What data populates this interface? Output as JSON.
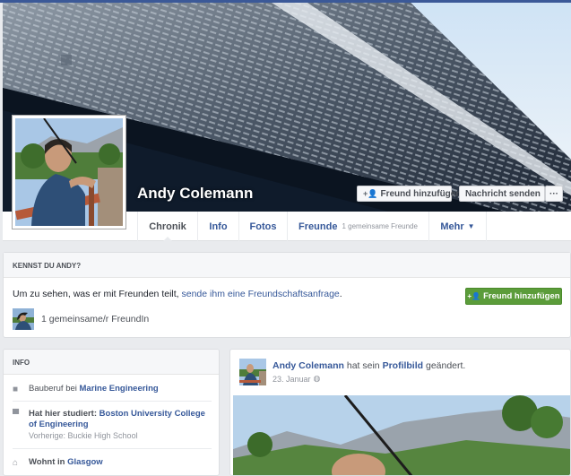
{
  "profile": {
    "name": "Andy Colemann"
  },
  "cover_actions": {
    "add_friend_label": "Freund hinzufügen",
    "send_message_label": "Nachricht senden",
    "more_label": "···"
  },
  "tabs": [
    {
      "label": "Chronik",
      "sub": ""
    },
    {
      "label": "Info",
      "sub": ""
    },
    {
      "label": "Fotos",
      "sub": ""
    },
    {
      "label": "Freunde",
      "sub": "1 gemeinsame Freunde"
    },
    {
      "label": "Mehr",
      "sub": ""
    }
  ],
  "kennst": {
    "heading": "KENNST DU ANDY?",
    "text_prefix": "Um zu sehen, was er mit Freunden teilt, ",
    "text_link": "sende ihm eine Freundschaftsanfrage",
    "text_suffix": ".",
    "button_label": "Freund hinzufügen",
    "mutual_label": "1 gemeinsame/r FreundIn"
  },
  "info": {
    "heading": "INFO",
    "work_prefix": "Bauberuf bei ",
    "work_place": "Marine Engineering",
    "study_prefix": "Hat hier studiert: ",
    "study_place": "Boston University College of Engineering",
    "study_previous": "Vorherige: Buckie High School",
    "lives_prefix": "Wohnt in ",
    "lives_place": "Glasgow"
  },
  "post": {
    "author": "Andy Colemann",
    "action_prefix": " hat sein ",
    "action_object": "Profilbild",
    "action_suffix": " geändert.",
    "date": "23. Januar"
  },
  "colors": {
    "brand": "#3b5998",
    "link": "#365899",
    "add_friend_green": "#5b9c3a"
  },
  "icons": {
    "add_friend": "person-plus-icon",
    "work": "briefcase-icon",
    "education": "graduation-cap-icon",
    "home": "house-icon",
    "privacy": "globe-icon"
  }
}
